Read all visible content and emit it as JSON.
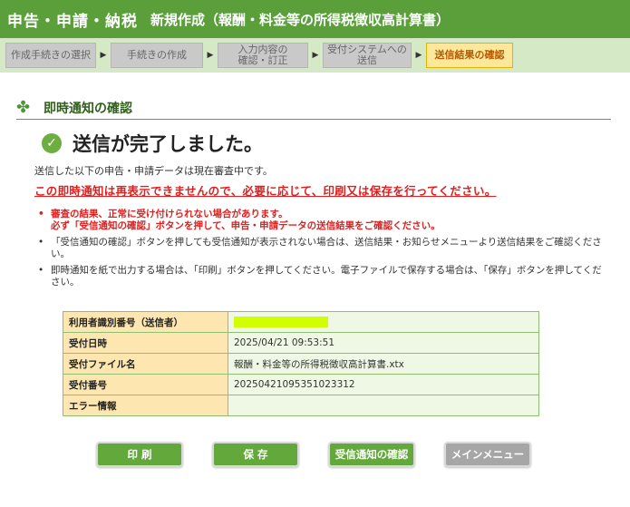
{
  "header": {
    "app_title": "申告・申請・納税",
    "sub_title": "新規作成（報酬・料金等の所得税徴収高計算書）"
  },
  "steps": [
    {
      "label": "作成手続きの選択"
    },
    {
      "label": "手続きの作成"
    },
    {
      "label": "入力内容の\n確認・訂正"
    },
    {
      "label": "受付システムへの\n送信"
    },
    {
      "label": "送信結果の確認"
    }
  ],
  "section": {
    "title": "即時通知の確認"
  },
  "status": {
    "message": "送信が完了しました。",
    "description": "送信した以下の申告・申請データは現在審査中です。",
    "warning": "この即時通知は再表示できませんので、必要に応じて、印刷又は保存を行ってください。"
  },
  "notes": [
    "審査の結果、正常に受け付けられない場合があります。\n必ず「受信通知の確認」ボタンを押して、申告・申請データの送信結果をご確認ください。",
    "「受信通知の確認」ボタンを押しても受信通知が表示されない場合は、送信結果・お知らせメニューより送信結果をご確認ください。",
    "即時通知を紙で出力する場合は、「印刷」ボタンを押してください。電子ファイルで保存する場合は、「保存」ボタンを押してください。"
  ],
  "info_table": {
    "rows": [
      {
        "label": "利用者識別番号（送信者）",
        "value": ""
      },
      {
        "label": "受付日時",
        "value": "2025/04/21 09:53:51"
      },
      {
        "label": "受付ファイル名",
        "value": "報酬・料金等の所得税徴収高計算書.xtx"
      },
      {
        "label": "受付番号",
        "value": "20250421095351023312"
      },
      {
        "label": "エラー情報",
        "value": ""
      }
    ]
  },
  "buttons": {
    "print": "印 刷",
    "save": "保 存",
    "receipt": "受信通知の確認",
    "main_menu": "メインメニュー"
  },
  "colors": {
    "header_green": "#5a9f3a",
    "step_active_bg": "#fde79a",
    "warning_red": "#e21f1f",
    "table_label_bg": "#fde6b0",
    "table_value_bg": "#eef8e4",
    "masked_value": "#d2ff00"
  },
  "icons": {
    "section": "clover-icon",
    "status": "check-circle-icon",
    "step_separator": "triangle-right-icon"
  }
}
